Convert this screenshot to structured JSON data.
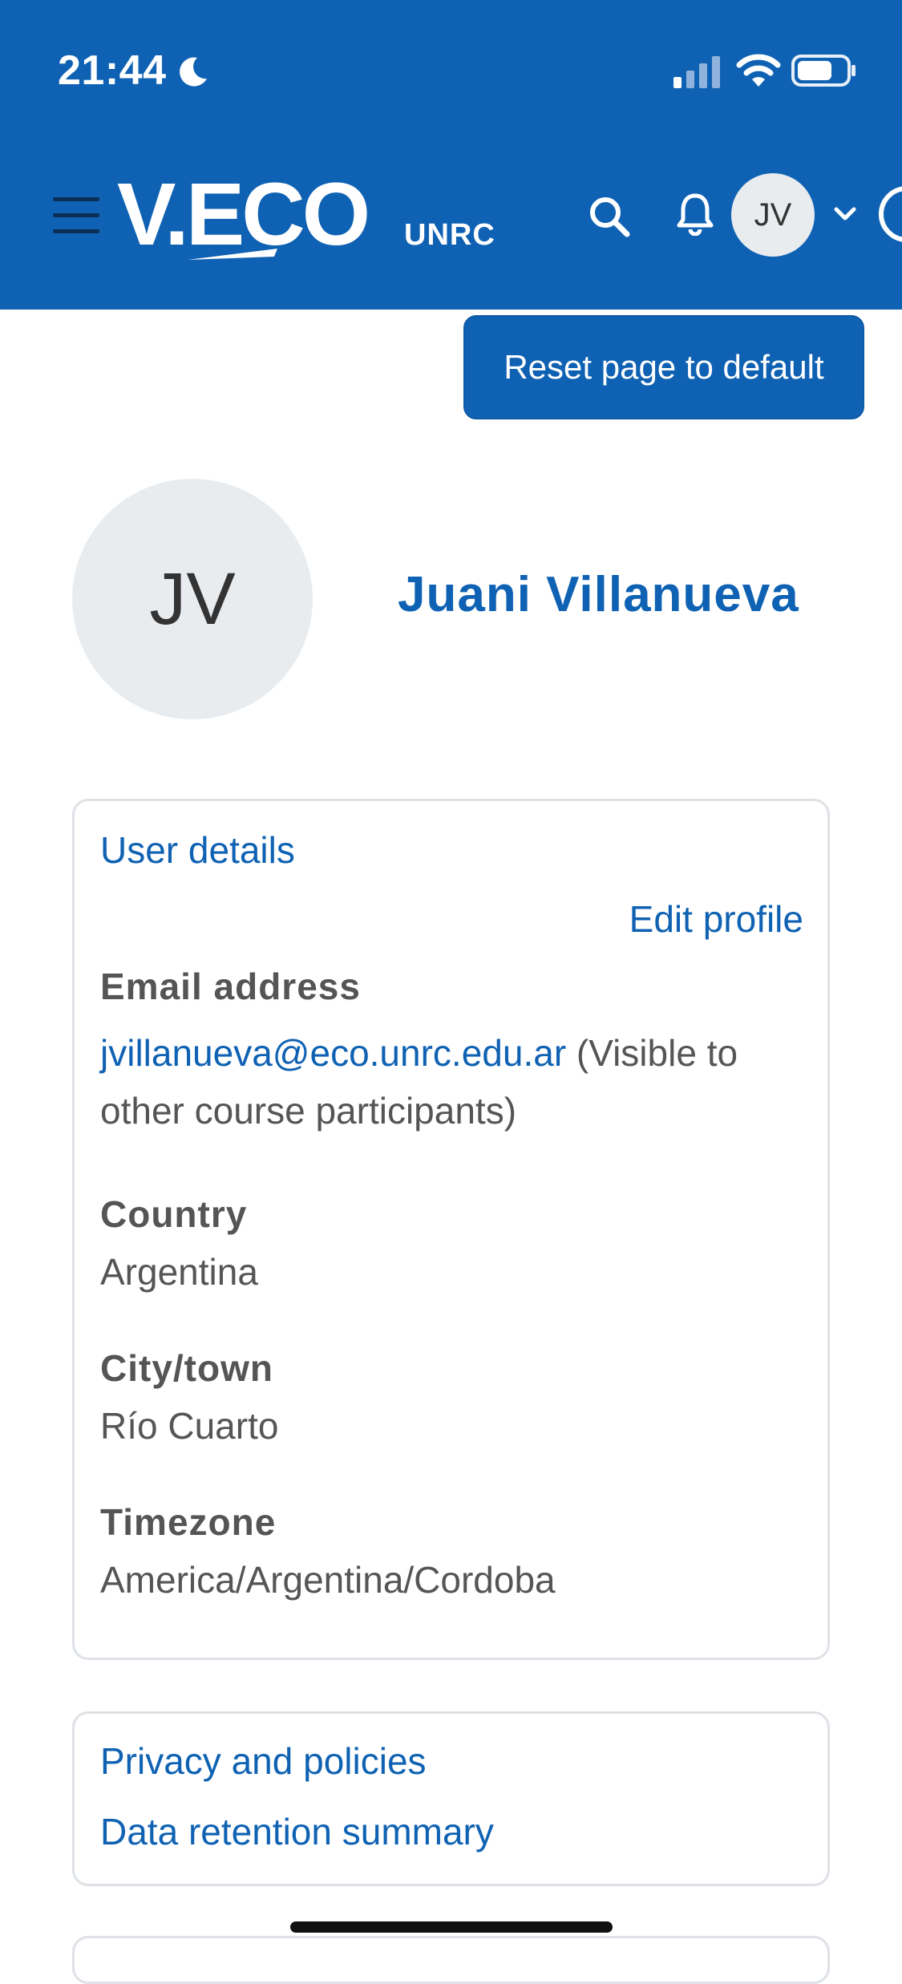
{
  "status_bar": {
    "time": "21:44"
  },
  "header": {
    "logo_text": "V.ECO",
    "logo_suffix": "UNRC",
    "avatar_initials": "JV"
  },
  "actions": {
    "reset_label": "Reset page to default"
  },
  "profile": {
    "initials": "JV",
    "name": "Juani Villanueva"
  },
  "user_details": {
    "title": "User details",
    "edit_label": "Edit profile",
    "email_label": "Email address",
    "email_value": "jvillanueva@eco.unrc.edu.ar",
    "email_note": " (Visible to other course participants)",
    "country_label": "Country",
    "country_value": "Argentina",
    "city_label": "City/town",
    "city_value": "Río Cuarto",
    "timezone_label": "Timezone",
    "timezone_value": "America/Argentina/Cordoba"
  },
  "privacy": {
    "privacy_label": "Privacy and policies",
    "retention_label": "Data retention summary"
  },
  "colors": {
    "brand": "#0f62b3",
    "text_muted": "#555555",
    "avatar_bg": "#e9ecef"
  }
}
